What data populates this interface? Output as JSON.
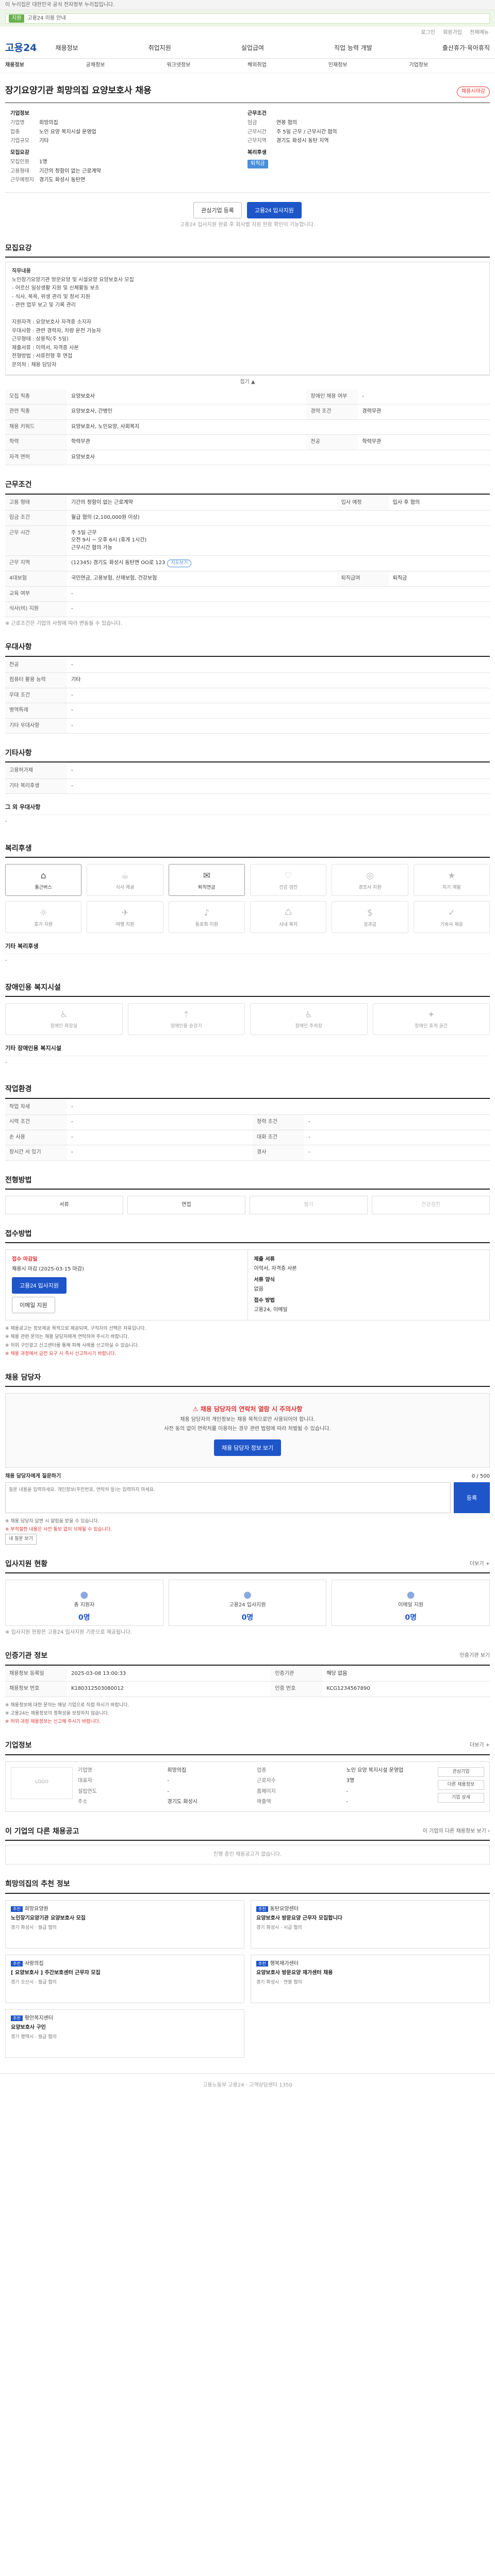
{
  "topbar": {
    "notice": "이 누리집은 대한민국 공식 전자정부 누리집입니다."
  },
  "ribbon": {
    "badge": "지원",
    "text": "고용24 이용 안내"
  },
  "util": {
    "login": "로그인",
    "join": "회원가입",
    "sitemap": "전체메뉴"
  },
  "header": {
    "logo": "고용24",
    "nav": [
      "채용정보",
      "취업지원",
      "실업급여",
      "직업 능력 개발",
      "출산휴가·육아휴직"
    ]
  },
  "subnav": [
    "채용정보",
    "공채정보",
    "워크넷정보",
    "해외취업",
    "인재정보",
    "기업정보"
  ],
  "job": {
    "title": "장기요양기관 희망의집 요양보호사 채용",
    "deadline": "채용시마감",
    "company_label": "기업정보",
    "company": [
      [
        "기업명",
        "희망의집"
      ],
      [
        "업종",
        "노인 요양 복지시설 운영업"
      ],
      [
        "기업규모",
        "기타"
      ]
    ],
    "recruit_label": "모집요강",
    "recruit": [
      [
        "모집인원",
        "1명"
      ],
      [
        "고용형태",
        "기간의 정함이 없는 근로계약"
      ],
      [
        "근무예정지",
        "경기도 화성시 동탄면"
      ]
    ],
    "cond_label": "근무조건",
    "cond": [
      [
        "임금",
        "연봉 협의"
      ],
      [
        "근무시간",
        "주 5일 근무 / 근무시간 협의"
      ],
      [
        "근무지역",
        "경기도 화성시 동탄 지역"
      ]
    ],
    "tags_label": "복리후생",
    "tag": "퇴직금"
  },
  "buttons": {
    "interest": "관심기업 등록",
    "apply": "고용24 입사지원"
  },
  "apply_note": "고용24 입사지원 완료 후 회사별 지원 현황 확인이 가능합니다.",
  "sec_req": {
    "title": "모집요강",
    "toggle": "접기 ▲",
    "duty_title": "직무내용",
    "duty_text": "노인장기요양기관 방문요양 및 시설요양 요양보호사 모집\n- 어르신 일상생활 지원 및 신체활동 보조\n- 식사, 목욕, 위생 관리 및 정서 지원\n- 관련 업무 보고 및 기록 관리\n\n지원자격 : 요양보호사 자격증 소지자\n우대사항 : 관련 경력자, 차량 운전 가능자\n근무형태 : 상용직(주 5일)\n제출서류 : 이력서, 자격증 사본\n전형방법 : 서류전형 후 면접\n문의처 : 채용 담당자",
    "rows": [
      [
        "모집 직종",
        "요양보호사",
        "장애인 채용 여부",
        "-"
      ],
      [
        "관련 직종",
        "요양보호사, 간병인",
        "경력 조건",
        "경력무관"
      ],
      [
        "채용 키워드",
        "요양보호사, 노인요양, 사회복지",
        "",
        ""
      ],
      [
        "학력",
        "학력무관",
        "전공",
        "학력무관"
      ],
      [
        "자격 면허",
        "요양보호사",
        "",
        ""
      ]
    ]
  },
  "sec_cond": {
    "title": "근무조건",
    "rows": [
      [
        "고용 형태",
        "기간의 정함이 없는 근로계약",
        "입사 예정",
        "입사 후 협의"
      ],
      [
        "임금 조건",
        "월급 협의 (2,100,000원 이상)",
        "",
        ""
      ],
      [
        "근무 시간",
        "주 5일 근무\n오전 9시 ~ 오후 6시 (휴게 1시간)\n근무시간 협의 가능",
        "",
        ""
      ],
      [
        "근무 지역",
        "(12345) 경기도 화성시 동탄면 OO로 123",
        "",
        ""
      ],
      [
        "4대보험",
        "국민연금, 고용보험, 산재보험, 건강보험",
        "퇴직급여",
        "퇴직금"
      ],
      [
        "교육 여부",
        "-",
        "",
        ""
      ],
      [
        "식사(비) 지원",
        "-",
        "",
        ""
      ]
    ],
    "chip": "지도보기",
    "footnote": "※ 근로조건은 기업의 사정에 따라 변동될 수 있습니다."
  },
  "sec_pref": {
    "title": "우대사항",
    "rows": [
      [
        "전공",
        "-"
      ],
      [
        "컴퓨터 활용 능력",
        "기타"
      ],
      [
        "우대 조건",
        "-"
      ],
      [
        "병역특례",
        "-"
      ],
      [
        "기타 우대사항",
        "-"
      ]
    ]
  },
  "sec_etc": {
    "title": "기타사항",
    "rows": [
      [
        "고용허가제",
        "-"
      ],
      [
        "기타 복리후생",
        "-"
      ]
    ],
    "extra_title": "그 외 우대사항",
    "extra_val": "-"
  },
  "sec_welfare": {
    "title": "복리후생",
    "items": [
      [
        "⌂",
        "통근버스"
      ],
      [
        "☕",
        "식사 제공"
      ],
      [
        "✉",
        "퇴직연금"
      ],
      [
        "♡",
        "건강 검진"
      ],
      [
        "◎",
        "경조사 지원"
      ],
      [
        "★",
        "자기 계발"
      ],
      [
        "☼",
        "휴가 지원"
      ],
      [
        "✈",
        "여행 지원"
      ],
      [
        "♪",
        "동호회 지원"
      ],
      [
        "♺",
        "사내 복지"
      ],
      [
        "$",
        "성과금"
      ],
      [
        "✓",
        "기숙사 제공"
      ]
    ],
    "other_title": "기타 복리후생",
    "other_val": "-"
  },
  "sec_access": {
    "title": "장애인용 복지시설",
    "items": [
      [
        "♿",
        "장애인 화장실"
      ],
      [
        "⇡",
        "장애인용 승강기"
      ],
      [
        "♿",
        "장애인 주차장"
      ],
      [
        "✦",
        "장애인 휴게 공간"
      ]
    ],
    "other_title": "기타 장애인용 복지시설",
    "other_val": "-"
  },
  "sec_env": {
    "title": "작업환경",
    "rows": [
      [
        "작업 자세",
        "-",
        "",
        ""
      ],
      [
        "시력 조건",
        "-",
        "청력 조건",
        "-"
      ],
      [
        "손 사용",
        "-",
        "대화 조건",
        "-"
      ],
      [
        "장시간 서 있기",
        "-",
        "경사",
        "-"
      ]
    ]
  },
  "sec_method": {
    "title": "전형방법",
    "items": [
      "서류",
      "면접",
      "필기",
      "건강검진"
    ]
  },
  "sec_apply": {
    "title": "접수방법",
    "period_label": "접수 마감일",
    "period": "채용시 마감 (2025-03-15 마감)",
    "apply_btn": "고용24 입사지원",
    "mail_btn": "이메일 지원",
    "docs_label": "제출 서류",
    "docs": "이력서, 자격증 사본",
    "form_label": "서류 양식",
    "form": "없음",
    "method_label": "접수 방법",
    "method": "고용24, 이메일",
    "notes": [
      "※ 채용공고는 정보제공 목적으로 제공되며, 구직자의 선택은 자유입니다.",
      "※ 채용 관련 문의는 채용 담당자에게 연락하여 주시기 바랍니다.",
      "※ 허위 구인광고 신고센터를 통해 피해 사례를 신고하실 수 있습니다."
    ],
    "red": "※ 채용 과정에서 금전 요구 시 즉시 신고하시기 바랍니다."
  },
  "sec_contact": {
    "title": "채용 담당자",
    "alert": "채용 담당자의 연락처 열람 시 주의사항",
    "lines": [
      "채용 담당자의 개인정보는 채용 목적으로만 사용되어야 합니다.",
      "사전 동의 없이 연락처를 이용하는 경우 관련 법령에 따라 처벌될 수 있습니다."
    ],
    "btn1": "채용 담당자 정보 보기",
    "q_label": "채용 담당자에게 질문하기",
    "q_count": "0 / 500",
    "q_placeholder": "질문 내용을 입력하세요. 개인정보(주민번호, 연락처 등)는 입력하지 마세요.",
    "q_send": "등록",
    "q_notes": [
      "※ 채용 담당자 답변 시 알림을 받을 수 있습니다.",
      "※ 부적절한 내용은 사전 통보 없이 삭제될 수 있습니다."
    ],
    "q_more": "내 질문 보기"
  },
  "sec_stats": {
    "title": "입사지원 현황",
    "more": "더보기 +",
    "cells": [
      [
        "총 지원자",
        "0명"
      ],
      [
        "고용24 입사지원",
        "0명"
      ],
      [
        "이메일 지원",
        "0명"
      ]
    ],
    "note": "※ 입사지원 현황은 고용24 입사지원 기준으로 제공됩니다."
  },
  "sec_manage": {
    "title": "인증기관 정보",
    "more": "인증기관 보기",
    "rows": [
      [
        "채용정보 등록일",
        "2025-03-08 13:00:33",
        "인증기관",
        "해당 없음"
      ],
      [
        "채용정보 번호",
        "K180312503080012",
        "인증 번호",
        "KCG1234567890"
      ]
    ],
    "notes": [
      "※ 채용정보에 대한 문의는 해당 기업으로 직접 하시기 바랍니다.",
      "※ 고용24는 채용정보의 정확성을 보장하지 않습니다."
    ],
    "red": "※ 허위·과장 채용정보는 신고해 주시기 바랍니다."
  },
  "sec_company": {
    "title": "기업정보",
    "more": "더보기 +",
    "logo": "LOGO",
    "info": [
      [
        "기업명",
        "희망의집"
      ],
      [
        "업종",
        "노인 요양 복지시설 운영업"
      ],
      [
        "대표자",
        "-"
      ],
      [
        "근로자수",
        "3명"
      ],
      [
        "설립연도",
        "-"
      ],
      [
        "홈페이지",
        "-"
      ],
      [
        "주소",
        "경기도 화성시"
      ],
      [
        "매출액",
        "-"
      ]
    ],
    "side": [
      "관심기업",
      "다른 채용정보",
      "기업 상세"
    ]
  },
  "sec_similar": {
    "title": "이 기업의 다른 채용공고",
    "more": "이 기업의 다른 채용정보 보기 ›",
    "empty": "진행 중인 채용공고가 없습니다."
  },
  "sec_rec": {
    "title": "희망의집의 추천 정보",
    "cards": [
      {
        "badge": "추천",
        "company": "희망요양원",
        "title": "노인장기요양기관 요양보호사 모집",
        "meta": "경기 화성시 · 월급 협의"
      },
      {
        "badge": "추천",
        "company": "동탄요양센터",
        "title": "요양보호사 방문요양 근무자 모집합니다",
        "meta": "경기 화성시 · 시급 협의"
      },
      {
        "badge": "추천",
        "company": "사랑의집",
        "title": "[ 요양보호사 ] 주간보호센터 근무자 모집",
        "meta": "경기 오산시 · 월급 협의"
      },
      {
        "badge": "추천",
        "company": "행복재가센터",
        "title": "요양보호사 방문요양 재가센터 채용",
        "meta": "경기 화성시 · 연봉 협의"
      },
      {
        "badge": "추천",
        "company": "평안복지센터",
        "title": "요양보호사 구인",
        "meta": "경기 평택시 · 월급 협의"
      }
    ]
  },
  "footer": {
    "text": "고용노동부 고용24 · 고객상담센터 1350"
  }
}
